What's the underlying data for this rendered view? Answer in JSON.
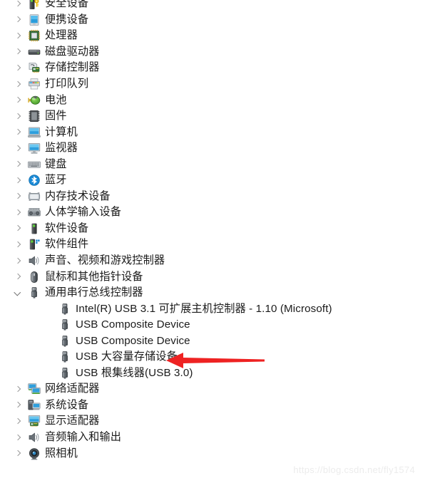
{
  "window": {
    "app": "Device Manager",
    "view": "device-tree"
  },
  "colors": {
    "text": "#1b1b1b",
    "chevron": "#9a9a9a",
    "annotation_red": "#ee2222",
    "watermark": "#ececec",
    "background": "#ffffff"
  },
  "tree": {
    "items": [
      {
        "label": "安全设备",
        "level": 0,
        "expander": "chevron-right-icon",
        "icon": "security-device-icon"
      },
      {
        "label": "便携设备",
        "level": 0,
        "expander": "chevron-right-icon",
        "icon": "portable-device-icon"
      },
      {
        "label": "处理器",
        "level": 0,
        "expander": "chevron-right-icon",
        "icon": "processor-icon"
      },
      {
        "label": "磁盘驱动器",
        "level": 0,
        "expander": "chevron-right-icon",
        "icon": "disk-drive-icon"
      },
      {
        "label": "存储控制器",
        "level": 0,
        "expander": "chevron-right-icon",
        "icon": "storage-controller-icon"
      },
      {
        "label": "打印队列",
        "level": 0,
        "expander": "chevron-right-icon",
        "icon": "print-queue-icon"
      },
      {
        "label": "电池",
        "level": 0,
        "expander": "chevron-right-icon",
        "icon": "battery-icon"
      },
      {
        "label": "固件",
        "level": 0,
        "expander": "chevron-right-icon",
        "icon": "firmware-icon"
      },
      {
        "label": "计算机",
        "level": 0,
        "expander": "chevron-right-icon",
        "icon": "computer-icon"
      },
      {
        "label": "监视器",
        "level": 0,
        "expander": "chevron-right-icon",
        "icon": "monitor-icon"
      },
      {
        "label": "键盘",
        "level": 0,
        "expander": "chevron-right-icon",
        "icon": "keyboard-icon"
      },
      {
        "label": "蓝牙",
        "level": 0,
        "expander": "chevron-right-icon",
        "icon": "bluetooth-icon"
      },
      {
        "label": "内存技术设备",
        "level": 0,
        "expander": "chevron-right-icon",
        "icon": "memory-technology-device-icon"
      },
      {
        "label": "人体学输入设备",
        "level": 0,
        "expander": "chevron-right-icon",
        "icon": "human-interface-device-icon"
      },
      {
        "label": "软件设备",
        "level": 0,
        "expander": "chevron-right-icon",
        "icon": "software-device-icon"
      },
      {
        "label": "软件组件",
        "level": 0,
        "expander": "chevron-right-icon",
        "icon": "software-component-icon"
      },
      {
        "label": "声音、视频和游戏控制器",
        "level": 0,
        "expander": "chevron-right-icon",
        "icon": "sound-video-game-controller-icon"
      },
      {
        "label": "鼠标和其他指针设备",
        "level": 0,
        "expander": "chevron-right-icon",
        "icon": "mouse-icon"
      },
      {
        "label": "通用串行总线控制器",
        "level": 0,
        "expander": "chevron-down-icon",
        "icon": "usb-controller-icon"
      },
      {
        "label": "Intel(R) USB 3.1 可扩展主机控制器 - 1.10 (Microsoft)",
        "level": 1,
        "expander": "none",
        "icon": "usb-device-icon"
      },
      {
        "label": "USB Composite Device",
        "level": 1,
        "expander": "none",
        "icon": "usb-device-icon"
      },
      {
        "label": "USB Composite Device",
        "level": 1,
        "expander": "none",
        "icon": "usb-device-icon"
      },
      {
        "label": "USB 大容量存储设备",
        "level": 1,
        "expander": "none",
        "icon": "usb-device-icon"
      },
      {
        "label": "USB 根集线器(USB 3.0)",
        "level": 1,
        "expander": "none",
        "icon": "usb-device-icon"
      },
      {
        "label": "网络适配器",
        "level": 0,
        "expander": "chevron-right-icon",
        "icon": "network-adapter-icon"
      },
      {
        "label": "系统设备",
        "level": 0,
        "expander": "chevron-right-icon",
        "icon": "system-device-icon"
      },
      {
        "label": "显示适配器",
        "level": 0,
        "expander": "chevron-right-icon",
        "icon": "display-adapter-icon"
      },
      {
        "label": "音频输入和输出",
        "level": 0,
        "expander": "chevron-right-icon",
        "icon": "audio-io-icon"
      },
      {
        "label": "照相机",
        "level": 0,
        "expander": "chevron-right-icon",
        "icon": "camera-icon"
      }
    ]
  },
  "annotation": {
    "type": "arrow",
    "direction": "left",
    "color": "#ee2222",
    "points_to": "USB 大容量存储设备"
  },
  "watermark": {
    "text": "https://blog.csdn.net/fly1574"
  }
}
